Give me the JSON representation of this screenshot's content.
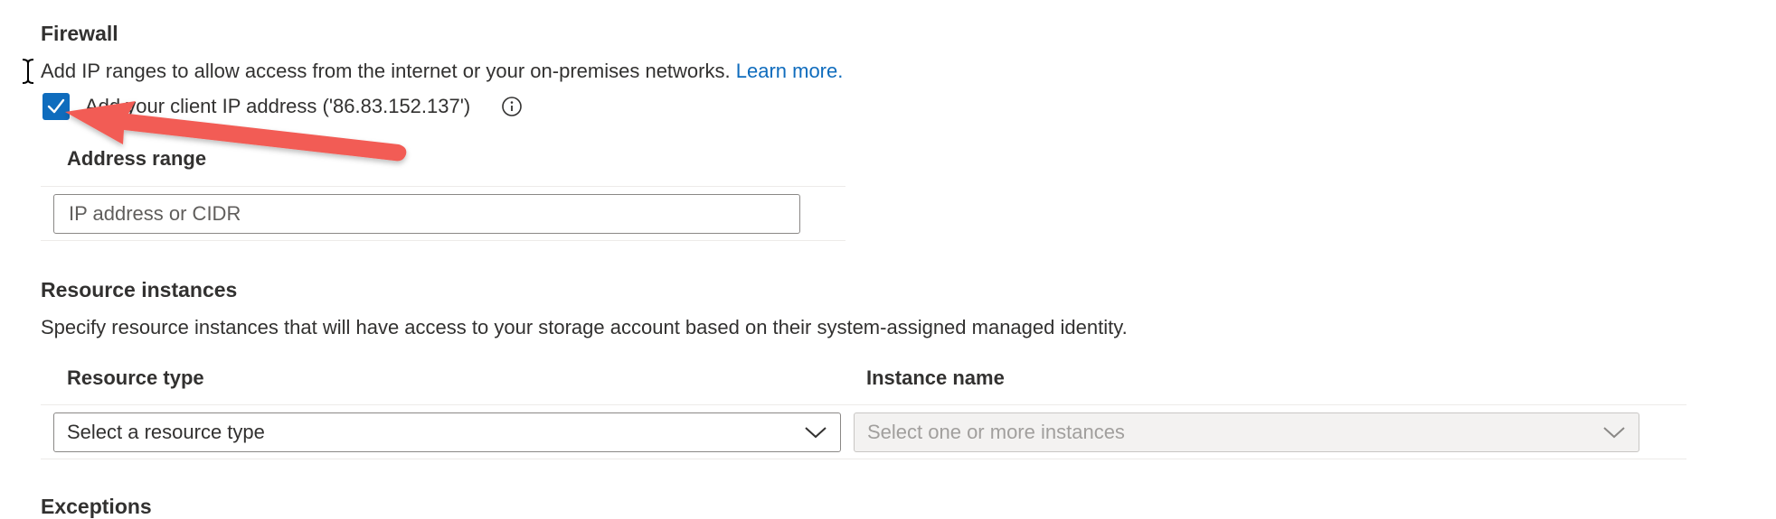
{
  "firewall": {
    "title": "Firewall",
    "description": "Add IP ranges to allow access from the internet or your on-premises networks.",
    "learn_more": "Learn more.",
    "client_ip_checkbox": {
      "label": "Add your client IP address ('86.83.152.137')",
      "checked": true
    },
    "address_range_header": "Address range",
    "address_input_placeholder": "IP address or CIDR"
  },
  "resource_instances": {
    "title": "Resource instances",
    "description": "Specify resource instances that will have access to your storage account based on their system-assigned managed identity.",
    "resource_type_header": "Resource type",
    "instance_name_header": "Instance name",
    "resource_type_placeholder": "Select a resource type",
    "instance_placeholder": "Select one or more instances"
  },
  "exceptions": {
    "title": "Exceptions"
  },
  "colors": {
    "accent": "#0f6cbd",
    "annotation_arrow": "#f25c54"
  },
  "icons": [
    "text-cursor-icon",
    "checkmark-icon",
    "info-icon",
    "chevron-down-icon",
    "annotation-arrow"
  ]
}
